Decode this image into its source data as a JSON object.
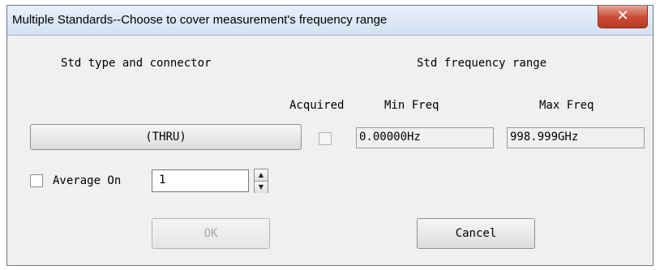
{
  "window": {
    "title": "Multiple Standards--Choose to cover measurement's frequency range"
  },
  "headers": {
    "std_type": "Std type and connector",
    "std_freq_range": "Std frequency range"
  },
  "columns": {
    "acquired": "Acquired",
    "min_freq": "Min Freq",
    "max_freq": "Max Freq"
  },
  "standard": {
    "button_label": "(THRU)",
    "acquired": false,
    "min_freq": "0.00000Hz",
    "max_freq": "998.999GHz"
  },
  "average": {
    "label": "Average On",
    "checked": false,
    "value": "1"
  },
  "buttons": {
    "ok": "OK",
    "cancel": "Cancel"
  },
  "icons": {
    "close": "close-icon",
    "spin_up": "chevron-up-icon",
    "spin_down": "chevron-down-icon"
  }
}
